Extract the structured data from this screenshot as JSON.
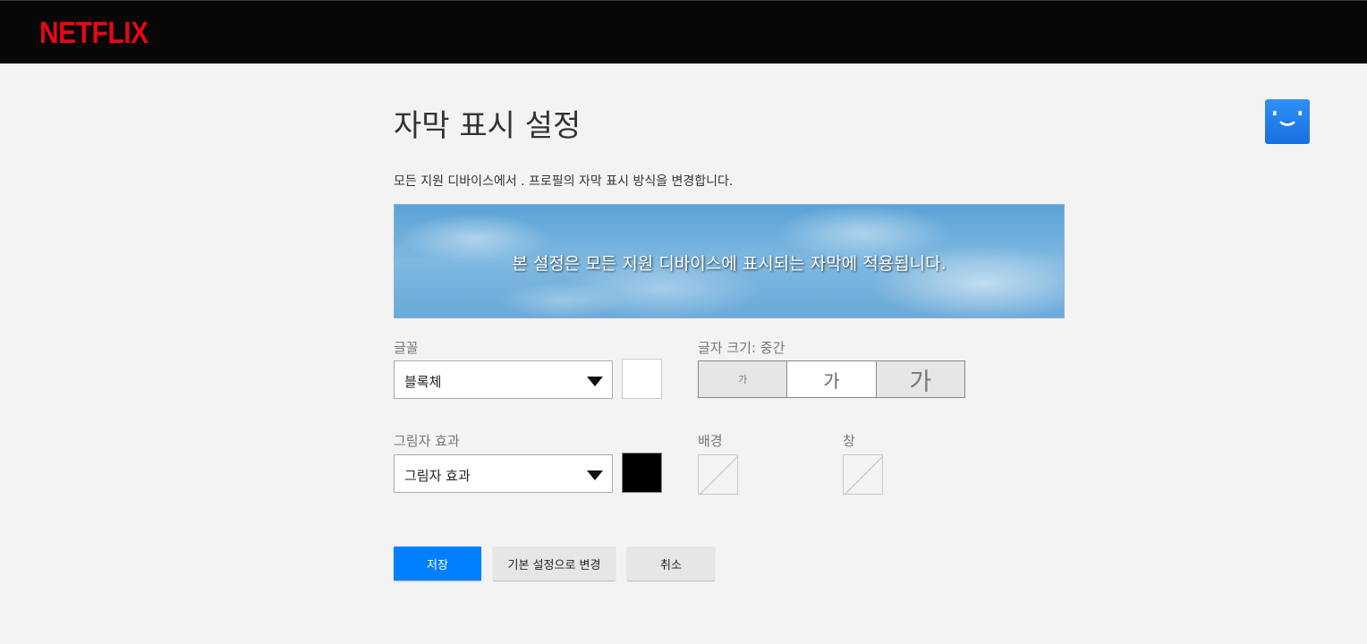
{
  "header": {
    "logo_text": "NETFLIX",
    "brand_color": "#e50914"
  },
  "profile": {
    "avatar_icon": "smiley-profile-icon",
    "avatar_color": "#2f8ff7"
  },
  "main": {
    "title": "자막 표시 설정",
    "subtitle": "모든 지원 디바이스에서 . 프로필의 자막 표시 방식을 변경합니다.",
    "preview_text": "본 설정은 모든 지원 디바이스에 표시되는 자막에 적용됩니다."
  },
  "font": {
    "label": "글꼴",
    "selected": "블록체",
    "color": "#ffffff"
  },
  "text_size": {
    "label": "글자 크기: 중간",
    "options": [
      "가",
      "가",
      "가"
    ],
    "selected_index": 1
  },
  "shadow": {
    "label": "그림자 효과",
    "selected": "그림자 효과",
    "color": "#000000"
  },
  "background": {
    "label": "배경",
    "value": "none"
  },
  "window": {
    "label": "창",
    "value": "none"
  },
  "actions": {
    "save": "저장",
    "reset": "기본 설정으로 변경",
    "cancel": "취소"
  }
}
